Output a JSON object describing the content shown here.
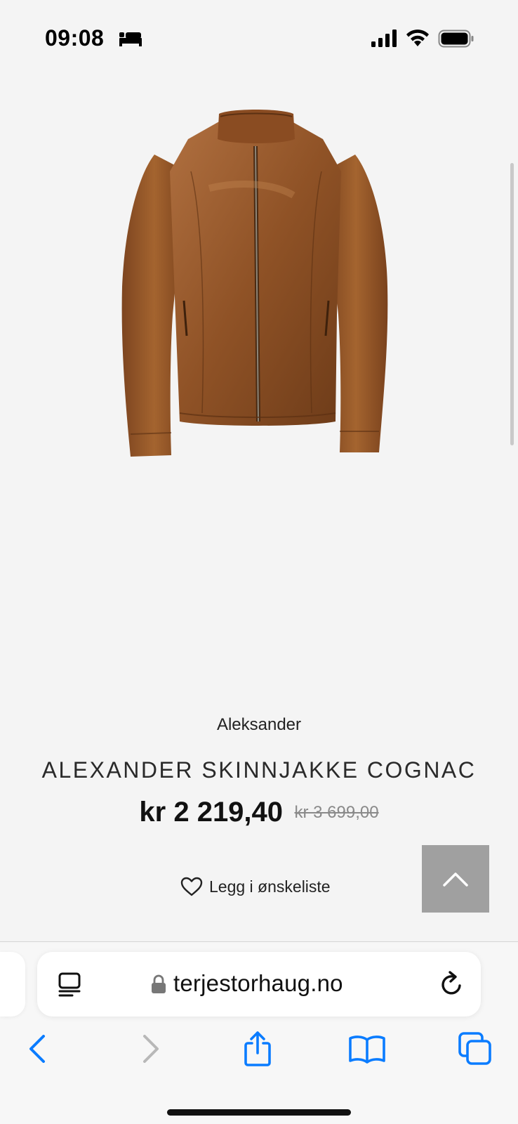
{
  "status_bar": {
    "time": "09:08",
    "icons": [
      "sleep-focus-icon",
      "cellular-signal-icon",
      "wifi-icon",
      "battery-icon"
    ]
  },
  "product": {
    "image": "brown-leather-jacket-image",
    "brand": "Aleksander",
    "title": "ALEXANDER SKINNJAKKE COGNAC",
    "price_current": "kr 2 219,40",
    "price_original": "kr 3 699,00",
    "wishlist_label": "Legg i ønskeliste"
  },
  "back_to_top": {
    "icon": "chevron-up-icon"
  },
  "browser": {
    "url": "terjestorhaug.no",
    "secure": true,
    "toolbar": [
      "back-icon",
      "forward-icon",
      "share-icon",
      "bookmarks-icon",
      "tabs-icon"
    ]
  },
  "colors": {
    "accent": "#0a7cff",
    "background": "#f4f4f4",
    "leather": "#9a5a2c",
    "back_to_top_bg": "#a0a0a0"
  }
}
